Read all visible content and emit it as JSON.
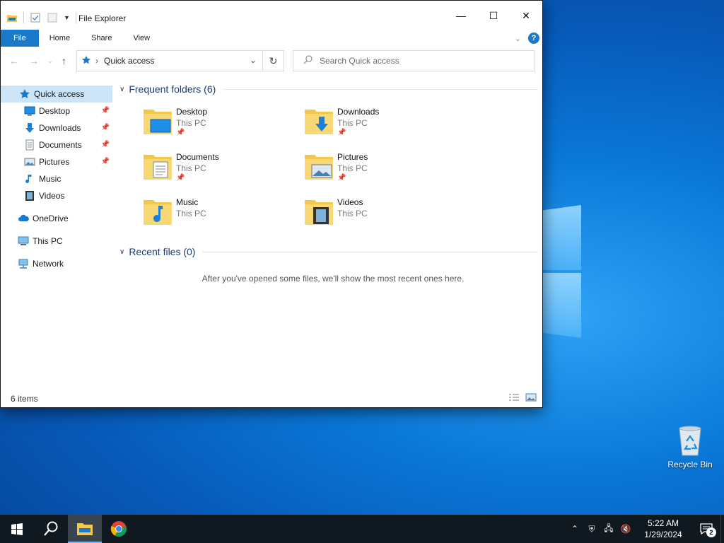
{
  "window": {
    "title": "File Explorer",
    "ribbon_tabs": [
      "File",
      "Home",
      "Share",
      "View"
    ]
  },
  "address": {
    "crumb": "Quick access"
  },
  "search": {
    "placeholder": "Search Quick access"
  },
  "sidebar": {
    "items": [
      {
        "label": "Quick access",
        "icon": "star-icon",
        "active": true
      },
      {
        "label": "Desktop",
        "icon": "desktop-icon",
        "pinned": true
      },
      {
        "label": "Downloads",
        "icon": "download-icon",
        "pinned": true
      },
      {
        "label": "Documents",
        "icon": "document-icon",
        "pinned": true
      },
      {
        "label": "Pictures",
        "icon": "picture-icon",
        "pinned": true
      },
      {
        "label": "Music",
        "icon": "music-icon"
      },
      {
        "label": "Videos",
        "icon": "video-icon"
      },
      {
        "label": "OneDrive",
        "icon": "cloud-icon"
      },
      {
        "label": "This PC",
        "icon": "computer-icon"
      },
      {
        "label": "Network",
        "icon": "network-icon"
      }
    ]
  },
  "frequent": {
    "heading": "Frequent folders (6)",
    "folders": [
      {
        "name": "Desktop",
        "location": "This PC",
        "pinned": true
      },
      {
        "name": "Downloads",
        "location": "This PC",
        "pinned": true
      },
      {
        "name": "Documents",
        "location": "This PC",
        "pinned": true
      },
      {
        "name": "Pictures",
        "location": "This PC",
        "pinned": true
      },
      {
        "name": "Music",
        "location": "This PC"
      },
      {
        "name": "Videos",
        "location": "This PC"
      }
    ]
  },
  "recent": {
    "heading": "Recent files (0)",
    "empty_message": "After you've opened some files, we'll show the most recent ones here."
  },
  "status": {
    "count": "6 items"
  },
  "desktop": {
    "recycle_bin": "Recycle Bin"
  },
  "taskbar": {
    "time": "5:22 AM",
    "date": "1/29/2024",
    "notification_count": "2"
  },
  "colors": {
    "accent": "#1979ca",
    "folder": "#f2c94c",
    "taskbar": "#101820"
  }
}
